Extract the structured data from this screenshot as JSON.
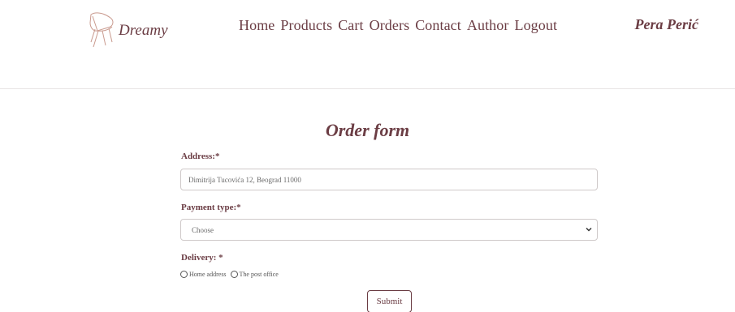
{
  "brand": {
    "name": "Dreamy",
    "icon": "chair-icon"
  },
  "nav": [
    "Home",
    "Products",
    "Cart",
    "Orders",
    "Contact",
    "Author",
    "Logout"
  ],
  "user": {
    "name": "Pera Perić"
  },
  "form": {
    "title": "Order form",
    "address_label": "Address:*",
    "address_value": "Dimitrija Tucovića 12, Beograd 11000",
    "payment_label": "Payment type:*",
    "payment_selected": "Choose",
    "delivery_label": "Delivery: *",
    "delivery_options": [
      "Home address",
      "The post office"
    ],
    "submit_label": "Submit"
  },
  "colors": {
    "accent": "#6b3d44",
    "border": "#cfc9c9"
  }
}
